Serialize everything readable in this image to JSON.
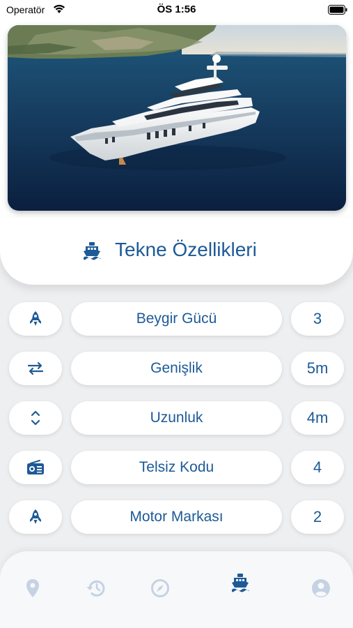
{
  "status_bar": {
    "carrier": "Operatör",
    "time": "ÖS 1:56"
  },
  "hero": {
    "icon": "yacht-photo"
  },
  "section": {
    "title": "Tekne Özellikleri",
    "icon": "ship-icon"
  },
  "specs": [
    {
      "icon": "rocket-icon",
      "label": "Beygir Gücü",
      "value": "3"
    },
    {
      "icon": "arrows-horizontal-icon",
      "label": "Genişlik",
      "value": "5m"
    },
    {
      "icon": "chevron-up-down-icon",
      "label": "Uzunluk",
      "value": "4m"
    },
    {
      "icon": "radio-icon",
      "label": "Telsiz Kodu",
      "value": "4"
    },
    {
      "icon": "rocket-icon",
      "label": "Motor Markası",
      "value": "2"
    }
  ],
  "tabs": [
    {
      "icon": "map-marker-icon",
      "active": false
    },
    {
      "icon": "history-icon",
      "active": false
    },
    {
      "icon": "compass-icon",
      "active": false
    },
    {
      "icon": "ship-icon",
      "active": true
    },
    {
      "icon": "user-circle-icon",
      "active": false
    }
  ],
  "colors": {
    "accent": "#1d5a96",
    "inactive_tab": "#c5d2e3",
    "background": "#eeeff1"
  }
}
